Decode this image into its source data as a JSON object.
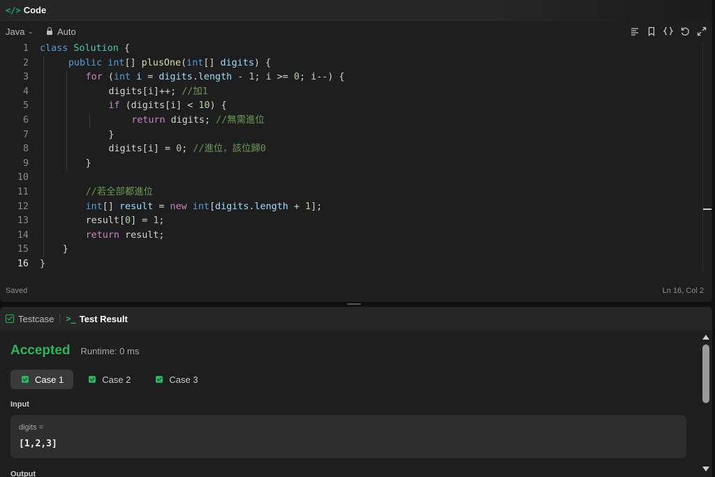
{
  "code_panel": {
    "icon": "code-brackets-icon",
    "icon_glyph": "</>",
    "title": "Code",
    "language": "Java",
    "mode": "Auto",
    "toolbar_icons": [
      "format-icon",
      "bookmark-icon",
      "braces-icon",
      "reset-icon",
      "expand-icon"
    ],
    "status_left": "Saved",
    "status_right": "Ln 16, Col 2",
    "lines": [
      {
        "n": "1",
        "tokens": [
          [
            "t-blue",
            "class"
          ],
          [
            "",
            " "
          ],
          [
            "t-type",
            "Solution"
          ],
          [
            "",
            " {"
          ]
        ]
      },
      {
        "n": "2",
        "tokens": [
          [
            "",
            " "
          ],
          [
            "t-blue",
            "public"
          ],
          [
            "",
            " "
          ],
          [
            "t-blue",
            "int"
          ],
          [
            "",
            "[] "
          ],
          [
            "t-fn",
            "plusOne"
          ],
          [
            "",
            "("
          ],
          [
            "t-blue",
            "int"
          ],
          [
            "",
            "[] "
          ],
          [
            "t-var",
            "digits"
          ],
          [
            "",
            ") {"
          ]
        ]
      },
      {
        "n": "3",
        "tokens": [
          [
            "t-kw",
            "for"
          ],
          [
            "",
            " ("
          ],
          [
            "t-blue",
            "int"
          ],
          [
            "",
            " "
          ],
          [
            "t-var",
            "i"
          ],
          [
            "",
            " = "
          ],
          [
            "t-var",
            "digits"
          ],
          [
            "",
            "."
          ],
          [
            "t-var",
            "length"
          ],
          [
            "",
            " - "
          ],
          [
            "t-num",
            "1"
          ],
          [
            "",
            "; i >= "
          ],
          [
            "t-num",
            "0"
          ],
          [
            "",
            "; i--) {"
          ]
        ]
      },
      {
        "n": "4",
        "tokens": [
          [
            "",
            "digits[i]++; "
          ],
          [
            "t-com",
            "//加1"
          ]
        ]
      },
      {
        "n": "5",
        "tokens": [
          [
            "t-kw",
            "if"
          ],
          [
            "",
            " (digits[i] < "
          ],
          [
            "t-num",
            "10"
          ],
          [
            "",
            ") {"
          ]
        ]
      },
      {
        "n": "6",
        "tokens": [
          [
            "t-kw",
            "return"
          ],
          [
            "",
            " digits; "
          ],
          [
            "t-com",
            "//無需進位"
          ]
        ]
      },
      {
        "n": "7",
        "tokens": [
          [
            "",
            "}"
          ]
        ]
      },
      {
        "n": "8",
        "tokens": [
          [
            "",
            "digits[i] = "
          ],
          [
            "t-num",
            "0"
          ],
          [
            "",
            "; "
          ],
          [
            "t-com",
            "//進位，該位歸0"
          ]
        ]
      },
      {
        "n": "9",
        "tokens": [
          [
            "",
            "}"
          ]
        ]
      },
      {
        "n": "10",
        "tokens": []
      },
      {
        "n": "11",
        "tokens": [
          [
            "t-com",
            "//若全部都進位"
          ]
        ]
      },
      {
        "n": "12",
        "tokens": [
          [
            "t-blue",
            "int"
          ],
          [
            "",
            "[] "
          ],
          [
            "t-var",
            "result"
          ],
          [
            "",
            " = "
          ],
          [
            "t-kw",
            "new"
          ],
          [
            "",
            " "
          ],
          [
            "t-blue",
            "int"
          ],
          [
            "",
            "["
          ],
          [
            "t-var",
            "digits"
          ],
          [
            "",
            "."
          ],
          [
            "t-var",
            "length"
          ],
          [
            "",
            " + "
          ],
          [
            "t-num",
            "1"
          ],
          [
            "",
            "];"
          ]
        ]
      },
      {
        "n": "13",
        "tokens": [
          [
            "",
            "result["
          ],
          [
            "t-num",
            "0"
          ],
          [
            "",
            "] = "
          ],
          [
            "t-num",
            "1"
          ],
          [
            "",
            ";"
          ]
        ]
      },
      {
        "n": "14",
        "tokens": [
          [
            "t-kw",
            "return"
          ],
          [
            "",
            " result;"
          ]
        ]
      },
      {
        "n": "15",
        "tokens": [
          [
            "",
            "}"
          ]
        ]
      },
      {
        "n": "16",
        "tokens": [
          [
            "",
            "}"
          ]
        ]
      }
    ]
  },
  "result_panel": {
    "tabs": [
      {
        "label": "Testcase",
        "icon": "checkbox-icon"
      },
      {
        "label": "Test Result",
        "icon": "terminal-icon",
        "icon_glyph": ">_"
      }
    ],
    "verdict": "Accepted",
    "runtime": "Runtime: 0 ms",
    "cases": [
      "Case 1",
      "Case 2",
      "Case 3"
    ],
    "input_label": "Input",
    "input_var": "digits =",
    "input_value": "[1,2,3]",
    "output_label": "Output"
  },
  "colors": {
    "accent_green": "#2db55d",
    "background": "#1e1e1e",
    "header": "#262626"
  }
}
